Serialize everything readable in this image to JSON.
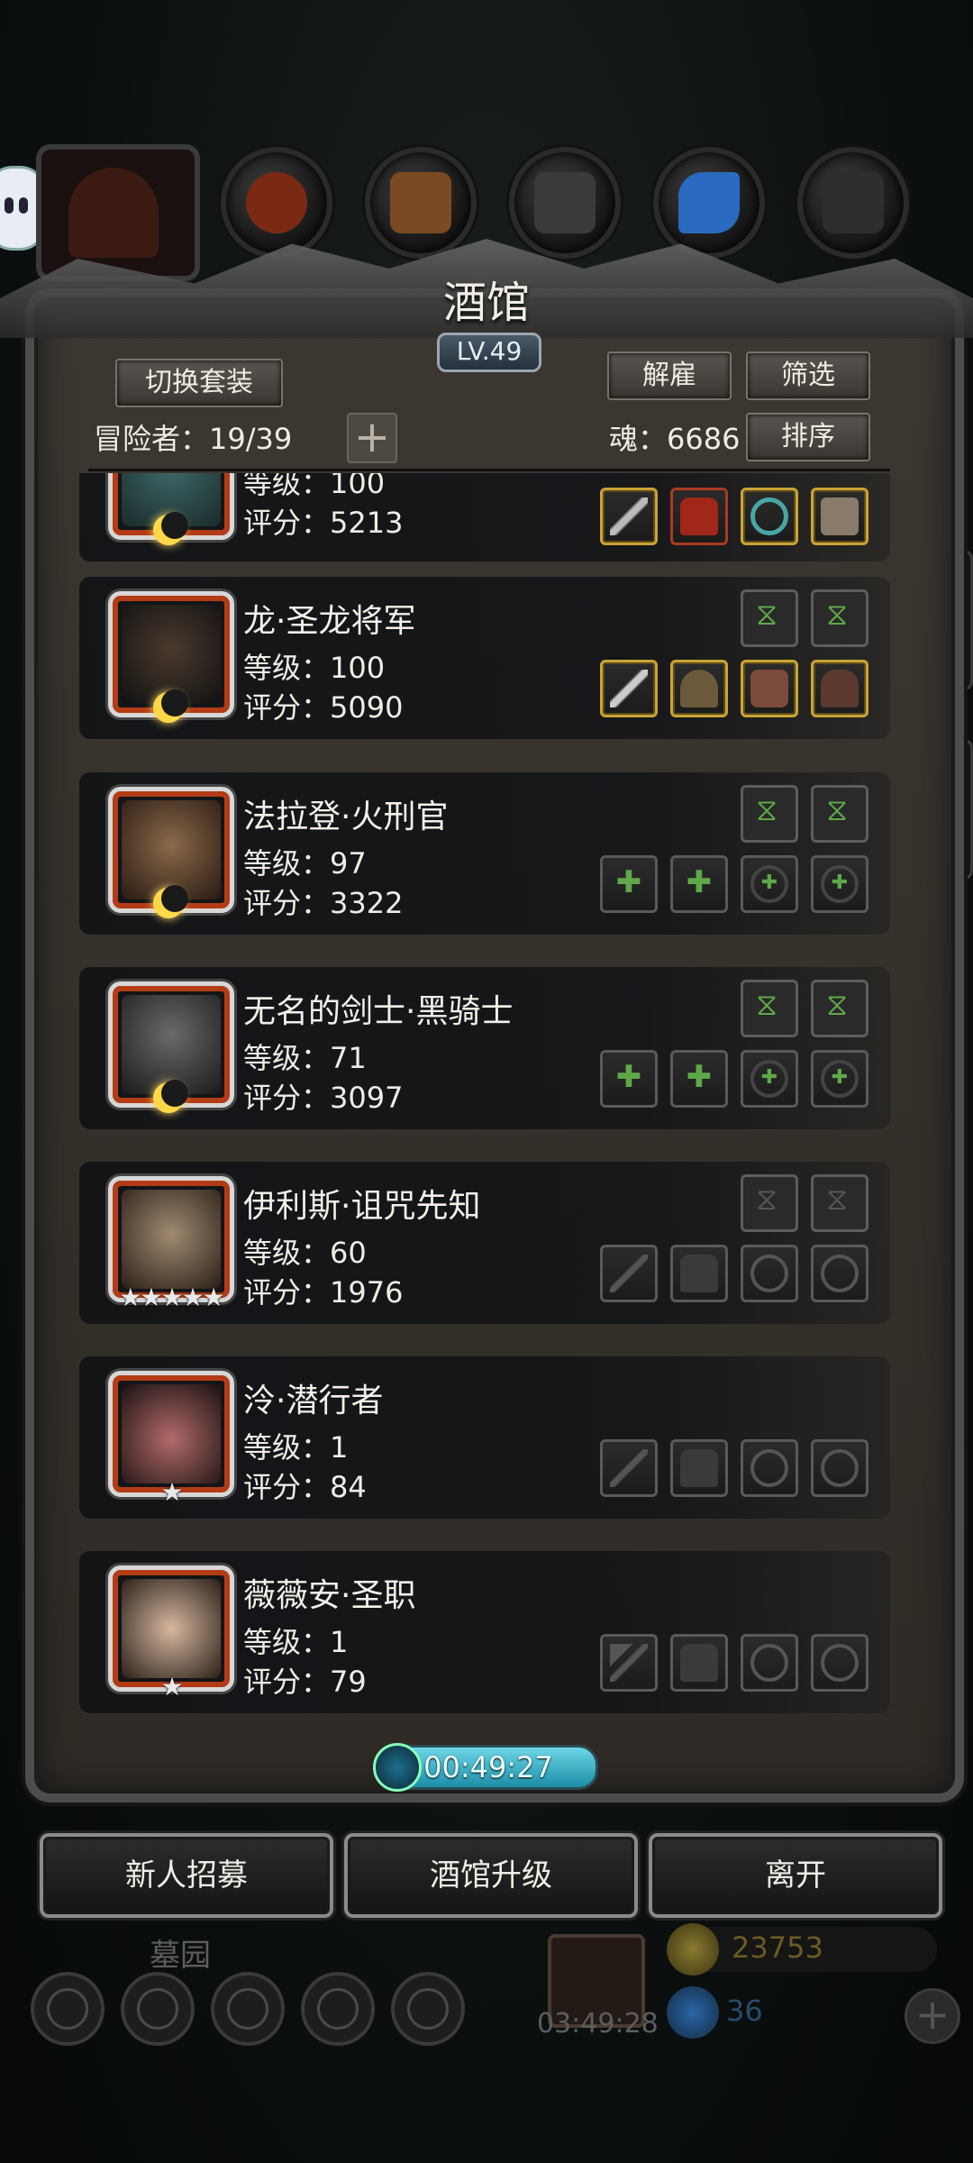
{
  "header": {
    "title": "酒馆",
    "level": "LV.49",
    "switch_outfit_label": "切换套装",
    "dismiss_label": "解雇",
    "filter_label": "筛选",
    "sort_label": "排序",
    "adventurers_label": "冒险者：19/39",
    "souls_label": "魂：6686",
    "add_label": "+"
  },
  "adventurers": [
    {
      "name": "",
      "level": "等级：100",
      "score": "评分：5213",
      "rank": "moon",
      "slots": [
        "spear-icon",
        "red-armor-icon",
        "ring-icon",
        "gauntlet-icon"
      ]
    },
    {
      "name": "龙·圣龙将军",
      "level": "等级：100",
      "score": "评分：5090",
      "rank": "moon",
      "slots": [
        "spear-icon",
        "hooded-armor-icon",
        "bracer-icon",
        "cloak-icon"
      ]
    },
    {
      "name": "法拉登·火刑官",
      "level": "等级：97",
      "score": "评分：3322",
      "rank": "moon",
      "slots": [
        "sword-slot-icon",
        "armor-slot-icon",
        "ring-slot-icon",
        "ring-slot-icon"
      ]
    },
    {
      "name": "无名的剑士·黑骑士",
      "level": "等级：71",
      "score": "评分：3097",
      "rank": "moon",
      "slots": [
        "sword-slot-icon",
        "armor-slot-icon",
        "ring-slot-icon",
        "ring-slot-icon"
      ]
    },
    {
      "name": "伊利斯·诅咒先知",
      "level": "等级：60",
      "score": "评分：1976",
      "rank": "★★★★★",
      "slots": [
        "staff-slot-icon",
        "armor-slot-icon",
        "ring-slot-icon",
        "ring-slot-icon"
      ]
    },
    {
      "name": "泠·潜行者",
      "level": "等级：1",
      "score": "评分：84",
      "rank": "★",
      "slots": [
        "dagger-slot-icon",
        "armor-slot-icon",
        "ring-slot-icon",
        "ring-slot-icon"
      ]
    },
    {
      "name": "薇薇安·圣职",
      "level": "等级：1",
      "score": "评分：79",
      "rank": "★",
      "slots": [
        "mace-slot-icon",
        "armor-slot-icon",
        "ring-slot-icon",
        "ring-slot-icon"
      ]
    }
  ],
  "timer": "00:49:27",
  "buttons": {
    "recruit": "新人招募",
    "upgrade": "酒馆升级",
    "leave": "离开"
  },
  "hud": {
    "location": "墓园",
    "gift_timer": "03:49:28",
    "gold": "23753",
    "gems": "36"
  },
  "colors": {
    "panel_bg": "#35302a",
    "gold_border": "#c9a436",
    "timer_cyan": "#6ed6e6",
    "portrait_frame": "#b33c16",
    "slot_plus_green": "#5fa84a"
  }
}
